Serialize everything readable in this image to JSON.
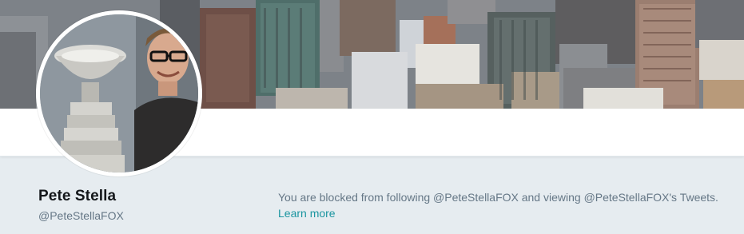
{
  "profile": {
    "name": "Pete Stella",
    "handle": "@PeteStellaFOX"
  },
  "blocked": {
    "message": "You are blocked from following @PeteStellaFOX and viewing @PeteStellaFOX's Tweets.",
    "learn_more_label": "Learn more"
  },
  "colors": {
    "accent_link": "#1b95a0",
    "background": "#e6ecf0",
    "name_text": "#14171a",
    "secondary_text": "#657786"
  },
  "images": {
    "header": "city-skyline-photo",
    "avatar": "man-with-trophy-photo"
  }
}
